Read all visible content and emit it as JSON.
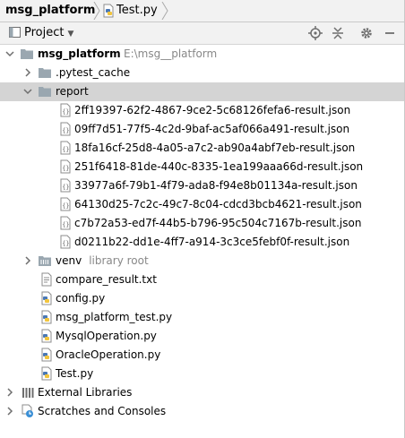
{
  "navbar": {
    "project": "msg_platform",
    "file": "Test.py"
  },
  "toolwindow": {
    "title": "Project"
  },
  "tree": {
    "root": {
      "name": "msg_platform",
      "path": "E:\\msg__platform"
    },
    "pytest_cache": ".pytest_cache",
    "report": "report",
    "report_files": [
      "2ff19397-62f2-4867-9ce2-5c68126fefa6-result.json",
      "09ff7d51-77f5-4c2d-9baf-ac5af066a491-result.json",
      "18fa16cf-25d8-4a05-a7c2-ab90a4abf7eb-result.json",
      "251f6418-81de-440c-8335-1ea199aaa66d-result.json",
      "33977a6f-79b1-4f79-ada8-f94e8b01134a-result.json",
      "64130d25-7c2c-49c7-8c04-cdcd3bcb4621-result.json",
      "c7b72a53-ed7f-44b5-b796-95c504c7167b-result.json",
      "d0211b22-dd1e-4ff7-a914-3c3ce5febf0f-result.json"
    ],
    "venv": {
      "name": "venv",
      "note": "library root"
    },
    "files": [
      "compare_result.txt",
      "config.py",
      "msg_platform_test.py",
      "MysqlOperation.py",
      "OracleOperation.py",
      "Test.py"
    ],
    "external_libraries": "External Libraries",
    "scratches": "Scratches and Consoles"
  }
}
